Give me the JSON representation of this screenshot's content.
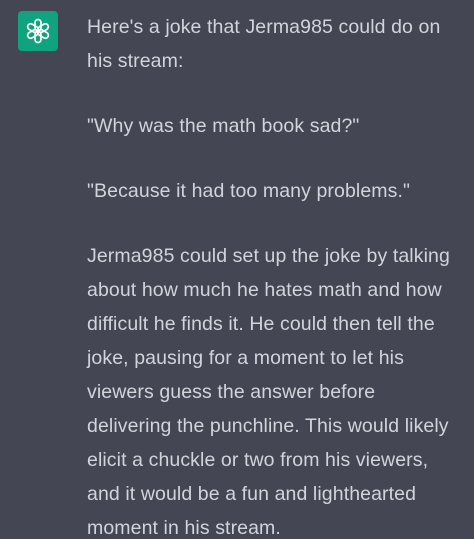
{
  "assistant": {
    "avatar_icon": "openai-logo-icon",
    "avatar_color": "#10a37f"
  },
  "message": {
    "paragraphs": [
      "Here's a joke that Jerma985 could do on his stream:",
      "\"Why was the math book sad?\"",
      "\"Because it had too many problems.\"",
      "Jerma985 could set up the joke by talking about how much he hates math and how difficult he finds it. He could then tell the joke, pausing for a moment to let his viewers guess the answer before delivering the punchline. This would likely elicit a chuckle or two from his viewers, and it would be a fun and lighthearted moment in his stream."
    ]
  },
  "colors": {
    "background": "#444654",
    "text": "#d1d5db"
  }
}
